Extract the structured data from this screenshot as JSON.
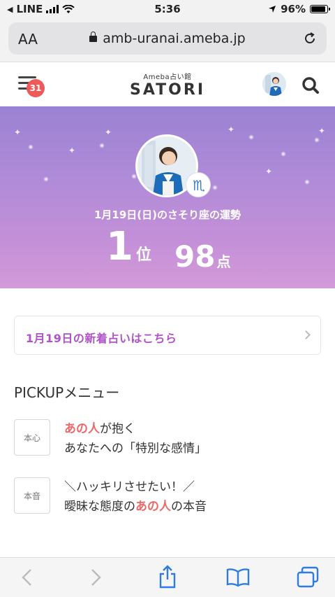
{
  "status_bar": {
    "carrier": "LINE",
    "time": "5:36",
    "battery": "96%"
  },
  "browser": {
    "text_size_label": "AA",
    "url": "amb-uranai.ameba.jp"
  },
  "header": {
    "menu_badge": "31",
    "logo_sub": "Ameba占い館",
    "logo_main": "SATORI"
  },
  "hero": {
    "date_text": "1月19日(日)のさそり座の運勢",
    "rank_value": "1",
    "rank_unit": "位",
    "points_value": "98",
    "points_unit": "点",
    "zodiac_icon": "scorpio-icon"
  },
  "new_fortune": {
    "label": "1月19日の新着占いはこちら"
  },
  "pickup": {
    "title": "PICKUPメニュー",
    "items": [
      {
        "tag": "本心",
        "line1_highlight": "あの人",
        "line1_rest": "が抱く",
        "line2": "あなたへの「特別な感情」"
      },
      {
        "tag": "本音",
        "line1": "＼ハッキリさせたい！／",
        "line2_pre": "曖昧な態度の",
        "line2_highlight": "あの人",
        "line2_post": "の本音"
      }
    ]
  },
  "colors": {
    "accent_purple": "#b051c8",
    "highlight_pink": "#ea6a6a",
    "badge_red": "#ee5a5a"
  }
}
